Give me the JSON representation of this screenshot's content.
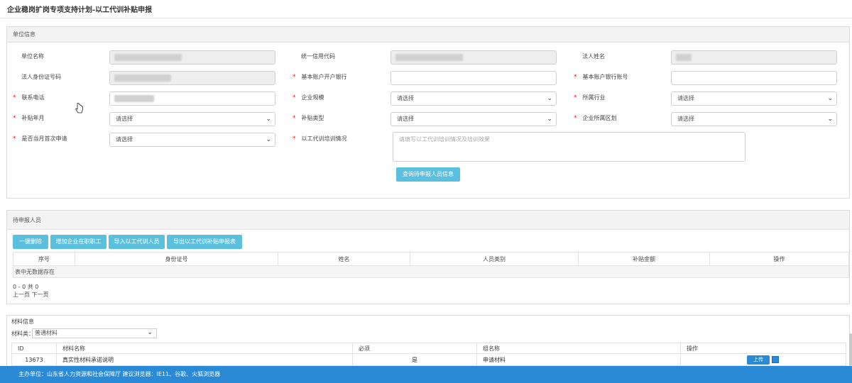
{
  "page_title": "企业稳岗扩岗专项支持计划-以工代训补贴申报",
  "unit_section": {
    "title": "单位信息",
    "labels": {
      "unit_name": "单位名称",
      "credit_code": "统一信用代码",
      "legal_name": "法人姓名",
      "legal_id": "法人身份证号码",
      "bank": "基本账户开户银行",
      "account": "基本账户银行账号",
      "phone": "联系电话",
      "scale": "企业规模",
      "industry": "所属行业",
      "subsidy_month": "补贴年月",
      "subsidy_type": "补贴类型",
      "district": "企业所属区划",
      "first_apply": "是否当月首次申请",
      "training": "以工代训培训情况"
    },
    "select_placeholder": "请选择",
    "training_placeholder": "请填写以工代训培训情况及培训效果",
    "query_button": "查询待申报人员信息"
  },
  "apply_section": {
    "title": "待申报人员",
    "buttons": [
      "一键删除",
      "增加企业在职职工",
      "导入以工代训人员",
      "导出以工代训补贴申报表"
    ],
    "columns": [
      "序号",
      "身份证号",
      "姓名",
      "人员类别",
      "补贴金额",
      "操作"
    ],
    "empty": "表中无数据存在",
    "count": "0 - 0 共 0",
    "pager": "上一页 下一页"
  },
  "material_section": {
    "title": "材料信息",
    "filter_label": "材料类：",
    "filter_value": "普通材料",
    "columns": [
      "ID",
      "材料名称",
      "必须",
      "组名称",
      "操作"
    ],
    "rows": [
      {
        "id": "13673",
        "name": "真实性材料承诺说明",
        "required": "是",
        "group": "申请材料",
        "action": "上传"
      }
    ]
  },
  "footer": {
    "text": "主办单位：山东省人力资源和社会保障厅  建议浏览器：IE11、谷歌、火狐浏览器"
  }
}
